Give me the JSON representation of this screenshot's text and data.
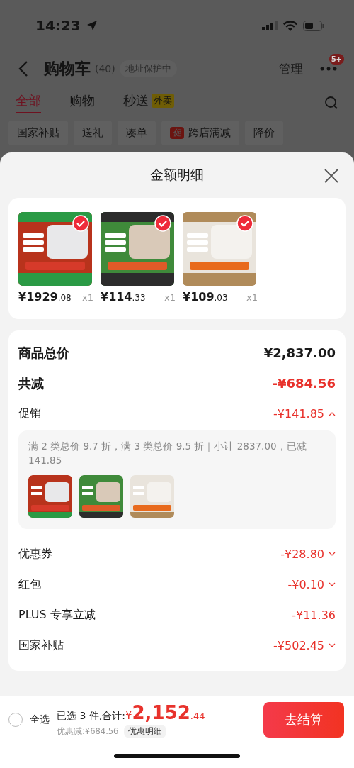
{
  "status_bar": {
    "time": "14:23"
  },
  "header": {
    "title": "购物车",
    "count": "(40)",
    "address": "地址保护中",
    "manage": "管理",
    "badge": "5+"
  },
  "tabs": [
    {
      "label": "全部",
      "selected": true
    },
    {
      "label": "购物",
      "selected": false
    },
    {
      "label": "秒送",
      "tag": "外卖",
      "selected": false
    }
  ],
  "filters": [
    {
      "label": "国家补贴"
    },
    {
      "label": "送礼"
    },
    {
      "label": "凑单"
    },
    {
      "label": "跨店满减",
      "tag": "促"
    },
    {
      "label": "降价"
    }
  ],
  "sheet": {
    "title": "金额明细"
  },
  "products": [
    {
      "kind": "picture",
      "price": "¥1929",
      "cents": ".08",
      "qty": "x1",
      "checked": true
    },
    {
      "kind": "picture",
      "price": "¥114",
      "cents": ".33",
      "qty": "x1",
      "checked": true
    },
    {
      "kind": "picture",
      "price": "¥109",
      "cents": ".03",
      "qty": "x1",
      "checked": true
    }
  ],
  "summary": [
    {
      "kind": "total",
      "label": "商品总价",
      "value": "¥2,837.00"
    },
    {
      "kind": "reduction",
      "label": "共减",
      "value": "-¥684.56"
    },
    {
      "kind": "item",
      "label": "促销",
      "value": "-¥141.85",
      "expanded": true
    },
    {
      "kind": "promo",
      "text": "满 2 类总价 9.7 折，满 3 类总价 9.5 折｜小计 2837.00，已减 141.85"
    },
    {
      "kind": "item",
      "label": "优惠券",
      "value": "-¥28.80",
      "expanded": false
    },
    {
      "kind": "item",
      "label": "红包",
      "value": "-¥0.10",
      "expanded": false
    },
    {
      "kind": "item",
      "label": "PLUS 专享立减",
      "value": "-¥11.36"
    },
    {
      "kind": "item",
      "label": "国家补贴",
      "value": "-¥502.45",
      "expanded": false
    }
  ],
  "bottom_bar": {
    "select_all": {
      "label": "全选",
      "checked": false
    },
    "selected_text": "已选 3 件,合计:",
    "currency": "¥",
    "total": "2,152",
    "cents": ".44",
    "saved": "优惠减:¥684.56",
    "detail_button": "优惠明细",
    "checkout": "去结算"
  }
}
